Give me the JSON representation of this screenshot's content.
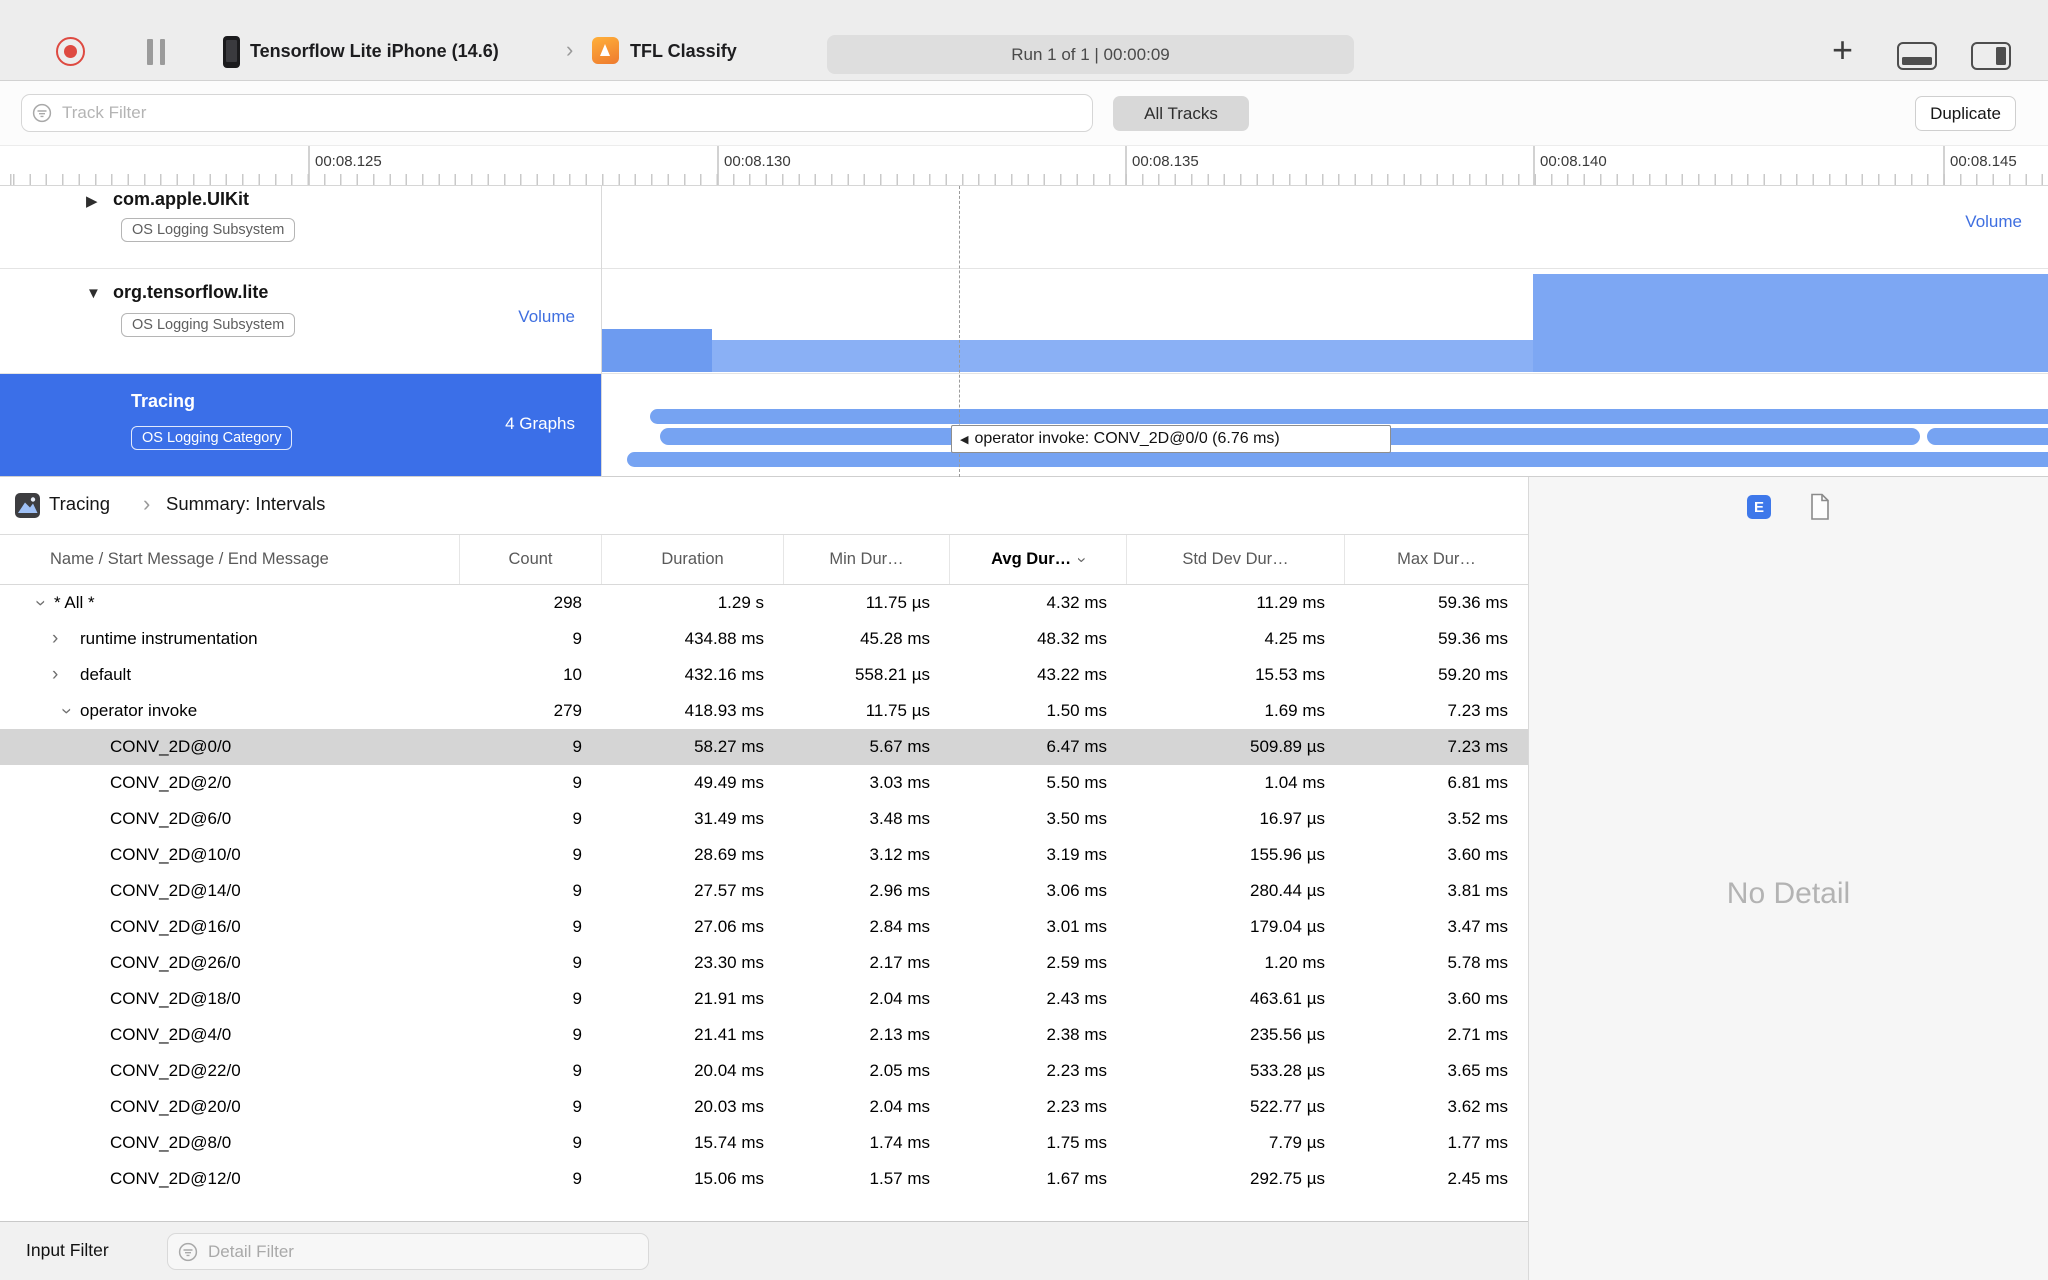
{
  "icons": {
    "plus": "+",
    "chevron_separator": "›",
    "disclosure_down": "▼",
    "disclosure_right": "▶",
    "row_chevron": "›",
    "sort_indicator": "›",
    "tooltip_arrow": "◀",
    "export_badge": "E"
  },
  "toolbar": {
    "device_name": "Tensorflow Lite iPhone (14.6)",
    "target_name": "TFL Classify",
    "run_status": "Run 1 of 1  |  00:00:09"
  },
  "filter_bar": {
    "track_filter_placeholder": "Track Filter",
    "all_tracks_label": "All Tracks",
    "duplicate_label": "Duplicate"
  },
  "timeline": {
    "ruler_labels": [
      "00:08.125",
      "00:08.130",
      "00:08.135",
      "00:08.140",
      "00:08.145"
    ],
    "tooltip": "operator invoke: CONV_2D@0/0 (6.76 ms)",
    "tracks": [
      {
        "title": "com.apple.UIKit",
        "badge": "OS Logging Subsystem",
        "meta": "Volume"
      },
      {
        "title": "org.tensorflow.lite",
        "badge": "OS Logging Subsystem",
        "meta": "Volume"
      },
      {
        "title": "Tracing",
        "badge": "OS Logging Category",
        "meta": "4 Graphs"
      }
    ]
  },
  "detail_pane": {
    "breadcrumb_root": "Tracing",
    "breadcrumb_page": "Summary: Intervals",
    "no_detail": "No Detail"
  },
  "table": {
    "columns": [
      "Name / Start Message / End Message",
      "Count",
      "Duration",
      "Min Dur…",
      "Avg Dur…",
      "Std Dev Dur…",
      "Max Dur…"
    ],
    "sorted_column": "Avg Dur…",
    "rows": [
      {
        "name": "* All *",
        "level": 0,
        "disclosure": "down",
        "selected": false,
        "count": "298",
        "duration": "1.29 s",
        "min": "11.75 µs",
        "avg": "4.32 ms",
        "std": "11.29 ms",
        "max": "59.36 ms"
      },
      {
        "name": "runtime instrumentation",
        "level": 1,
        "disclosure": "right",
        "selected": false,
        "count": "9",
        "duration": "434.88 ms",
        "min": "45.28 ms",
        "avg": "48.32 ms",
        "std": "4.25 ms",
        "max": "59.36 ms"
      },
      {
        "name": "default",
        "level": 1,
        "disclosure": "right",
        "selected": false,
        "count": "10",
        "duration": "432.16 ms",
        "min": "558.21 µs",
        "avg": "43.22 ms",
        "std": "15.53 ms",
        "max": "59.20 ms"
      },
      {
        "name": "operator invoke",
        "level": 1,
        "disclosure": "down",
        "selected": false,
        "count": "279",
        "duration": "418.93 ms",
        "min": "11.75 µs",
        "avg": "1.50 ms",
        "std": "1.69 ms",
        "max": "7.23 ms"
      },
      {
        "name": "CONV_2D@0/0",
        "level": 2,
        "disclosure": null,
        "selected": true,
        "count": "9",
        "duration": "58.27 ms",
        "min": "5.67 ms",
        "avg": "6.47 ms",
        "std": "509.89 µs",
        "max": "7.23 ms"
      },
      {
        "name": "CONV_2D@2/0",
        "level": 2,
        "disclosure": null,
        "selected": false,
        "count": "9",
        "duration": "49.49 ms",
        "min": "3.03 ms",
        "avg": "5.50 ms",
        "std": "1.04 ms",
        "max": "6.81 ms"
      },
      {
        "name": "CONV_2D@6/0",
        "level": 2,
        "disclosure": null,
        "selected": false,
        "count": "9",
        "duration": "31.49 ms",
        "min": "3.48 ms",
        "avg": "3.50 ms",
        "std": "16.97 µs",
        "max": "3.52 ms"
      },
      {
        "name": "CONV_2D@10/0",
        "level": 2,
        "disclosure": null,
        "selected": false,
        "count": "9",
        "duration": "28.69 ms",
        "min": "3.12 ms",
        "avg": "3.19 ms",
        "std": "155.96 µs",
        "max": "3.60 ms"
      },
      {
        "name": "CONV_2D@14/0",
        "level": 2,
        "disclosure": null,
        "selected": false,
        "count": "9",
        "duration": "27.57 ms",
        "min": "2.96 ms",
        "avg": "3.06 ms",
        "std": "280.44 µs",
        "max": "3.81 ms"
      },
      {
        "name": "CONV_2D@16/0",
        "level": 2,
        "disclosure": null,
        "selected": false,
        "count": "9",
        "duration": "27.06 ms",
        "min": "2.84 ms",
        "avg": "3.01 ms",
        "std": "179.04 µs",
        "max": "3.47 ms"
      },
      {
        "name": "CONV_2D@26/0",
        "level": 2,
        "disclosure": null,
        "selected": false,
        "count": "9",
        "duration": "23.30 ms",
        "min": "2.17 ms",
        "avg": "2.59 ms",
        "std": "1.20 ms",
        "max": "5.78 ms"
      },
      {
        "name": "CONV_2D@18/0",
        "level": 2,
        "disclosure": null,
        "selected": false,
        "count": "9",
        "duration": "21.91 ms",
        "min": "2.04 ms",
        "avg": "2.43 ms",
        "std": "463.61 µs",
        "max": "3.60 ms"
      },
      {
        "name": "CONV_2D@4/0",
        "level": 2,
        "disclosure": null,
        "selected": false,
        "count": "9",
        "duration": "21.41 ms",
        "min": "2.13 ms",
        "avg": "2.38 ms",
        "std": "235.56 µs",
        "max": "2.71 ms"
      },
      {
        "name": "CONV_2D@22/0",
        "level": 2,
        "disclosure": null,
        "selected": false,
        "count": "9",
        "duration": "20.04 ms",
        "min": "2.05 ms",
        "avg": "2.23 ms",
        "std": "533.28 µs",
        "max": "3.65 ms"
      },
      {
        "name": "CONV_2D@20/0",
        "level": 2,
        "disclosure": null,
        "selected": false,
        "count": "9",
        "duration": "20.03 ms",
        "min": "2.04 ms",
        "avg": "2.23 ms",
        "std": "522.77 µs",
        "max": "3.62 ms"
      },
      {
        "name": "CONV_2D@8/0",
        "level": 2,
        "disclosure": null,
        "selected": false,
        "count": "9",
        "duration": "15.74 ms",
        "min": "1.74 ms",
        "avg": "1.75 ms",
        "std": "7.79 µs",
        "max": "1.77 ms"
      },
      {
        "name": "CONV_2D@12/0",
        "level": 2,
        "disclosure": null,
        "selected": false,
        "count": "9",
        "duration": "15.06 ms",
        "min": "1.57 ms",
        "avg": "1.67 ms",
        "std": "292.75 µs",
        "max": "2.45 ms"
      }
    ]
  },
  "bottom_bar": {
    "input_filter_label": "Input Filter",
    "detail_filter_placeholder": "Detail Filter"
  }
}
